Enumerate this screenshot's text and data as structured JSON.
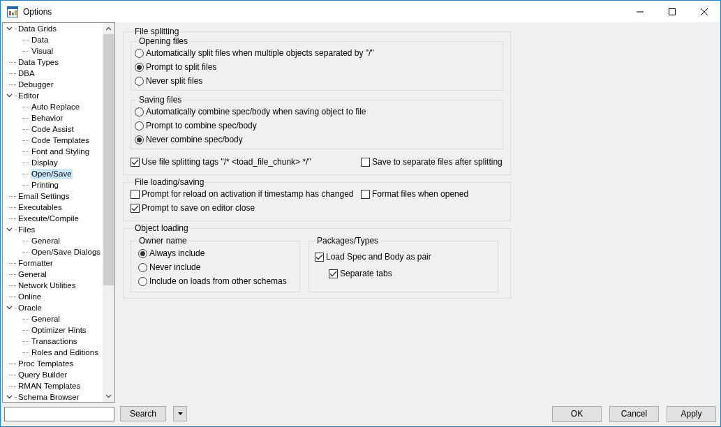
{
  "window": {
    "title": "Options"
  },
  "tree": [
    {
      "label": "Data Grids",
      "expanded": true,
      "selected": false,
      "children": [
        {
          "label": "Data",
          "selected": false
        },
        {
          "label": "Visual",
          "selected": false
        }
      ]
    },
    {
      "label": "Data Types",
      "selected": false
    },
    {
      "label": "DBA",
      "selected": false
    },
    {
      "label": "Debugger",
      "selected": false
    },
    {
      "label": "Editor",
      "expanded": true,
      "selected": false,
      "children": [
        {
          "label": "Auto Replace",
          "selected": false
        },
        {
          "label": "Behavior",
          "selected": false
        },
        {
          "label": "Code Assist",
          "selected": false
        },
        {
          "label": "Code Templates",
          "selected": false
        },
        {
          "label": "Font and Styling",
          "selected": false
        },
        {
          "label": "Display",
          "selected": false
        },
        {
          "label": "Open/Save",
          "selected": true
        },
        {
          "label": "Printing",
          "selected": false
        }
      ]
    },
    {
      "label": "Email Settings",
      "selected": false
    },
    {
      "label": "Executables",
      "selected": false
    },
    {
      "label": "Execute/Compile",
      "selected": false
    },
    {
      "label": "Files",
      "expanded": true,
      "selected": false,
      "children": [
        {
          "label": "General",
          "selected": false
        },
        {
          "label": "Open/Save Dialogs",
          "selected": false
        }
      ]
    },
    {
      "label": "Formatter",
      "selected": false
    },
    {
      "label": "General",
      "selected": false
    },
    {
      "label": "Network Utilities",
      "selected": false
    },
    {
      "label": "Online",
      "selected": false
    },
    {
      "label": "Oracle",
      "expanded": true,
      "selected": false,
      "children": [
        {
          "label": "General",
          "selected": false
        },
        {
          "label": "Optimizer Hints",
          "selected": false
        },
        {
          "label": "Transactions",
          "selected": false
        },
        {
          "label": "Roles and Editions",
          "selected": false
        }
      ]
    },
    {
      "label": "Proc Templates",
      "selected": false
    },
    {
      "label": "Query Builder",
      "selected": false
    },
    {
      "label": "RMAN Templates",
      "selected": false
    },
    {
      "label": "Schema Browser",
      "expanded": true,
      "selected": false
    }
  ],
  "sections": [
    {
      "title": "File splitting",
      "groups": [
        {
          "title": "Opening files",
          "options": [
            {
              "kind": "radio",
              "label": "Automatically split files when multiple objects separated by \"/\"",
              "checked": false
            },
            {
              "kind": "radio",
              "label": "Prompt to split files",
              "checked": true
            },
            {
              "kind": "radio",
              "label": "Never split files",
              "checked": false
            }
          ]
        },
        {
          "title": "Saving files",
          "options": [
            {
              "kind": "radio",
              "label": "Automatically combine spec/body when saving object to file",
              "checked": false
            },
            {
              "kind": "radio",
              "label": "Prompt to combine spec/body",
              "checked": false
            },
            {
              "kind": "radio",
              "label": "Never combine spec/body",
              "checked": true
            }
          ]
        }
      ],
      "rows": [
        [
          {
            "kind": "checkbox",
            "label": "Use file splitting tags \"/* <toad_file_chunk> */\"",
            "checked": true
          },
          {
            "kind": "checkbox",
            "label": "Save to separate files after splitting",
            "checked": false
          }
        ]
      ]
    },
    {
      "title": "File loading/saving",
      "rows": [
        [
          {
            "kind": "checkbox",
            "label": "Prompt for reload on activation if timestamp has changed",
            "checked": false
          },
          {
            "kind": "checkbox",
            "label": "Format files when opened",
            "checked": false
          }
        ],
        [
          {
            "kind": "checkbox",
            "label": "Prompt to save on editor close",
            "checked": true
          }
        ]
      ]
    },
    {
      "title": "Object loading",
      "groups": [
        {
          "title": "Owner name",
          "options": [
            {
              "kind": "radio",
              "label": "Always include",
              "checked": true
            },
            {
              "kind": "radio",
              "label": "Never include",
              "checked": false
            },
            {
              "kind": "radio",
              "label": "Include on loads from other schemas",
              "checked": false
            }
          ]
        },
        {
          "title": "Packages/Types",
          "options": [
            {
              "kind": "checkbox",
              "label": "Load Spec and Body as pair",
              "checked": true,
              "children": [
                {
                  "kind": "checkbox",
                  "label": "Separate tabs",
                  "checked": true
                }
              ]
            }
          ]
        }
      ]
    }
  ],
  "search_button": "Search",
  "buttons": [
    "OK",
    "Cancel",
    "Apply"
  ]
}
